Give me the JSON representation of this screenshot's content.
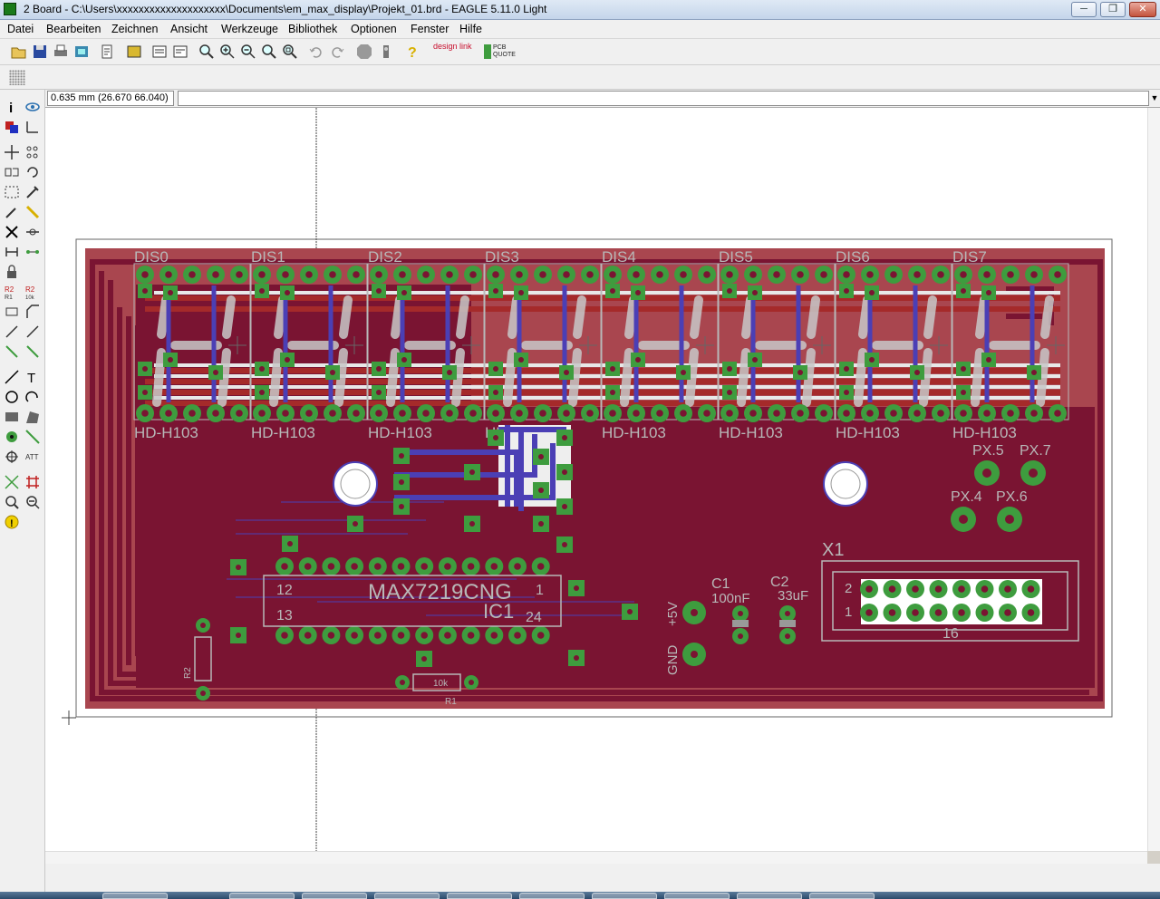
{
  "window": {
    "title": "2 Board - C:\\Users\\xxxxxxxxxxxxxxxxxxxx\\Documents\\em_max_display\\Projekt_01.brd - EAGLE 5.11.0 Light",
    "min_label": "─",
    "max_label": "❐",
    "close_label": "✕"
  },
  "menu": [
    "Datei",
    "Bearbeiten",
    "Zeichnen",
    "Ansicht",
    "Werkzeuge",
    "Bibliothek",
    "Optionen",
    "Fenster",
    "Hilfe"
  ],
  "toolbar": {
    "icons": [
      "open-icon",
      "save-icon",
      "print-icon",
      "cam-icon",
      "script-icon",
      "ulp-icon",
      "zoom-fit-icon",
      "zoom-in-icon",
      "zoom-out-icon",
      "zoom-redraw-icon",
      "zoom-select-icon",
      "undo-icon",
      "redo-icon",
      "stop-icon",
      "go-icon",
      "help-icon"
    ],
    "designlink_label": "design link",
    "pcbquote_label": "PCB QUOTE"
  },
  "coord": {
    "display": "0.635 mm (26.670 66.040)",
    "command": ""
  },
  "board": {
    "display_labels": [
      "DIS0",
      "DIS1",
      "DIS2",
      "DIS3",
      "DIS4",
      "DIS5",
      "DIS6",
      "DIS7"
    ],
    "display_value": "HD-H103",
    "ic_value": "MAX7219CNG",
    "ic_name": "IC1",
    "ic_pin_12": "12",
    "ic_pin_13": "13",
    "ic_pin_1": "1",
    "ic_pin_24": "24",
    "c1_name": "C1",
    "c1_value": "100nF",
    "c2_name": "C2",
    "c2_value": "33uF",
    "x1_name": "X1",
    "x1_pin_2": "2",
    "x1_pin_1": "1",
    "x1_pin_16": "16",
    "px_labels": [
      "PX.5",
      "PX.7",
      "PX.4",
      "PX.6"
    ],
    "vcc_label": "+5V",
    "gnd_label": "GND",
    "r1_value": "10k",
    "r1_name": "R1",
    "r2_name": "R2"
  },
  "colors": {
    "copper_top": "#a52a2a",
    "copper_bottom": "#4b3fb5",
    "pad": "#3e9c3e",
    "silkscreen": "#b8b8b8",
    "board_fill": "#7a1432"
  }
}
